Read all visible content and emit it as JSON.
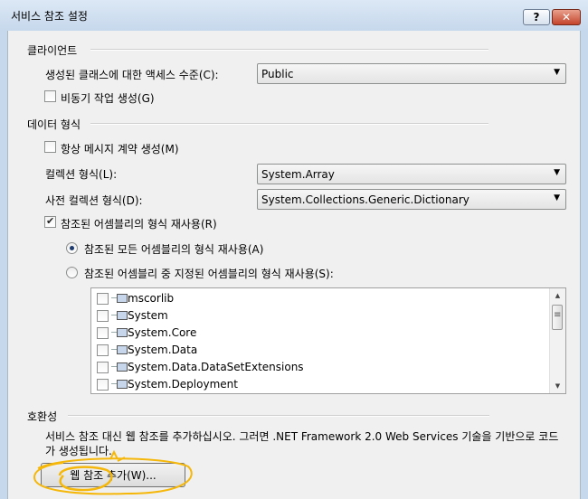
{
  "window": {
    "title": "서비스 참조 설정",
    "help_label": "?",
    "close_label": "✕"
  },
  "client": {
    "section_label": "클라이언트",
    "access_level_label": "생성된 클래스에 대한 액세스 수준(C):",
    "access_level_value": "Public",
    "async_label": "비동기 작업 생성(G)",
    "async_checked": false
  },
  "data_type": {
    "section_label": "데이터 형식",
    "always_message_contract_label": "항상 메시지 계약 생성(M)",
    "always_message_contract_checked": false,
    "collection_type_label": "컬렉션 형식(L):",
    "collection_type_value": "System.Array",
    "dictionary_type_label": "사전 컬렉션 형식(D):",
    "dictionary_type_value": "System.Collections.Generic.Dictionary",
    "reuse_types_label": "참조된 어셈블리의 형식 재사용(R)",
    "reuse_types_checked": true,
    "reuse_all_label": "참조된 모든 어셈블리의 형식 재사용(A)",
    "reuse_specified_label": "참조된 어셈블리 중 지정된 어셈블리의 형식 재사용(S):",
    "selected_reuse_option": "all",
    "assemblies": [
      {
        "name": "mscorlib",
        "checked": false
      },
      {
        "name": "System",
        "checked": false
      },
      {
        "name": "System.Core",
        "checked": false
      },
      {
        "name": "System.Data",
        "checked": false
      },
      {
        "name": "System.Data.DataSetExtensions",
        "checked": false
      },
      {
        "name": "System.Deployment",
        "checked": false
      }
    ]
  },
  "compatibility": {
    "section_label": "호환성",
    "description": "서비스 참조 대신 웹 참조를 추가하십시오. 그러면 .NET Framework 2.0 Web Services 기술을 기반으로 코드가 생성됩니다.",
    "add_web_reference_label": "웹 참조 추가(W)..."
  },
  "annotation_color": "#f5b70a"
}
